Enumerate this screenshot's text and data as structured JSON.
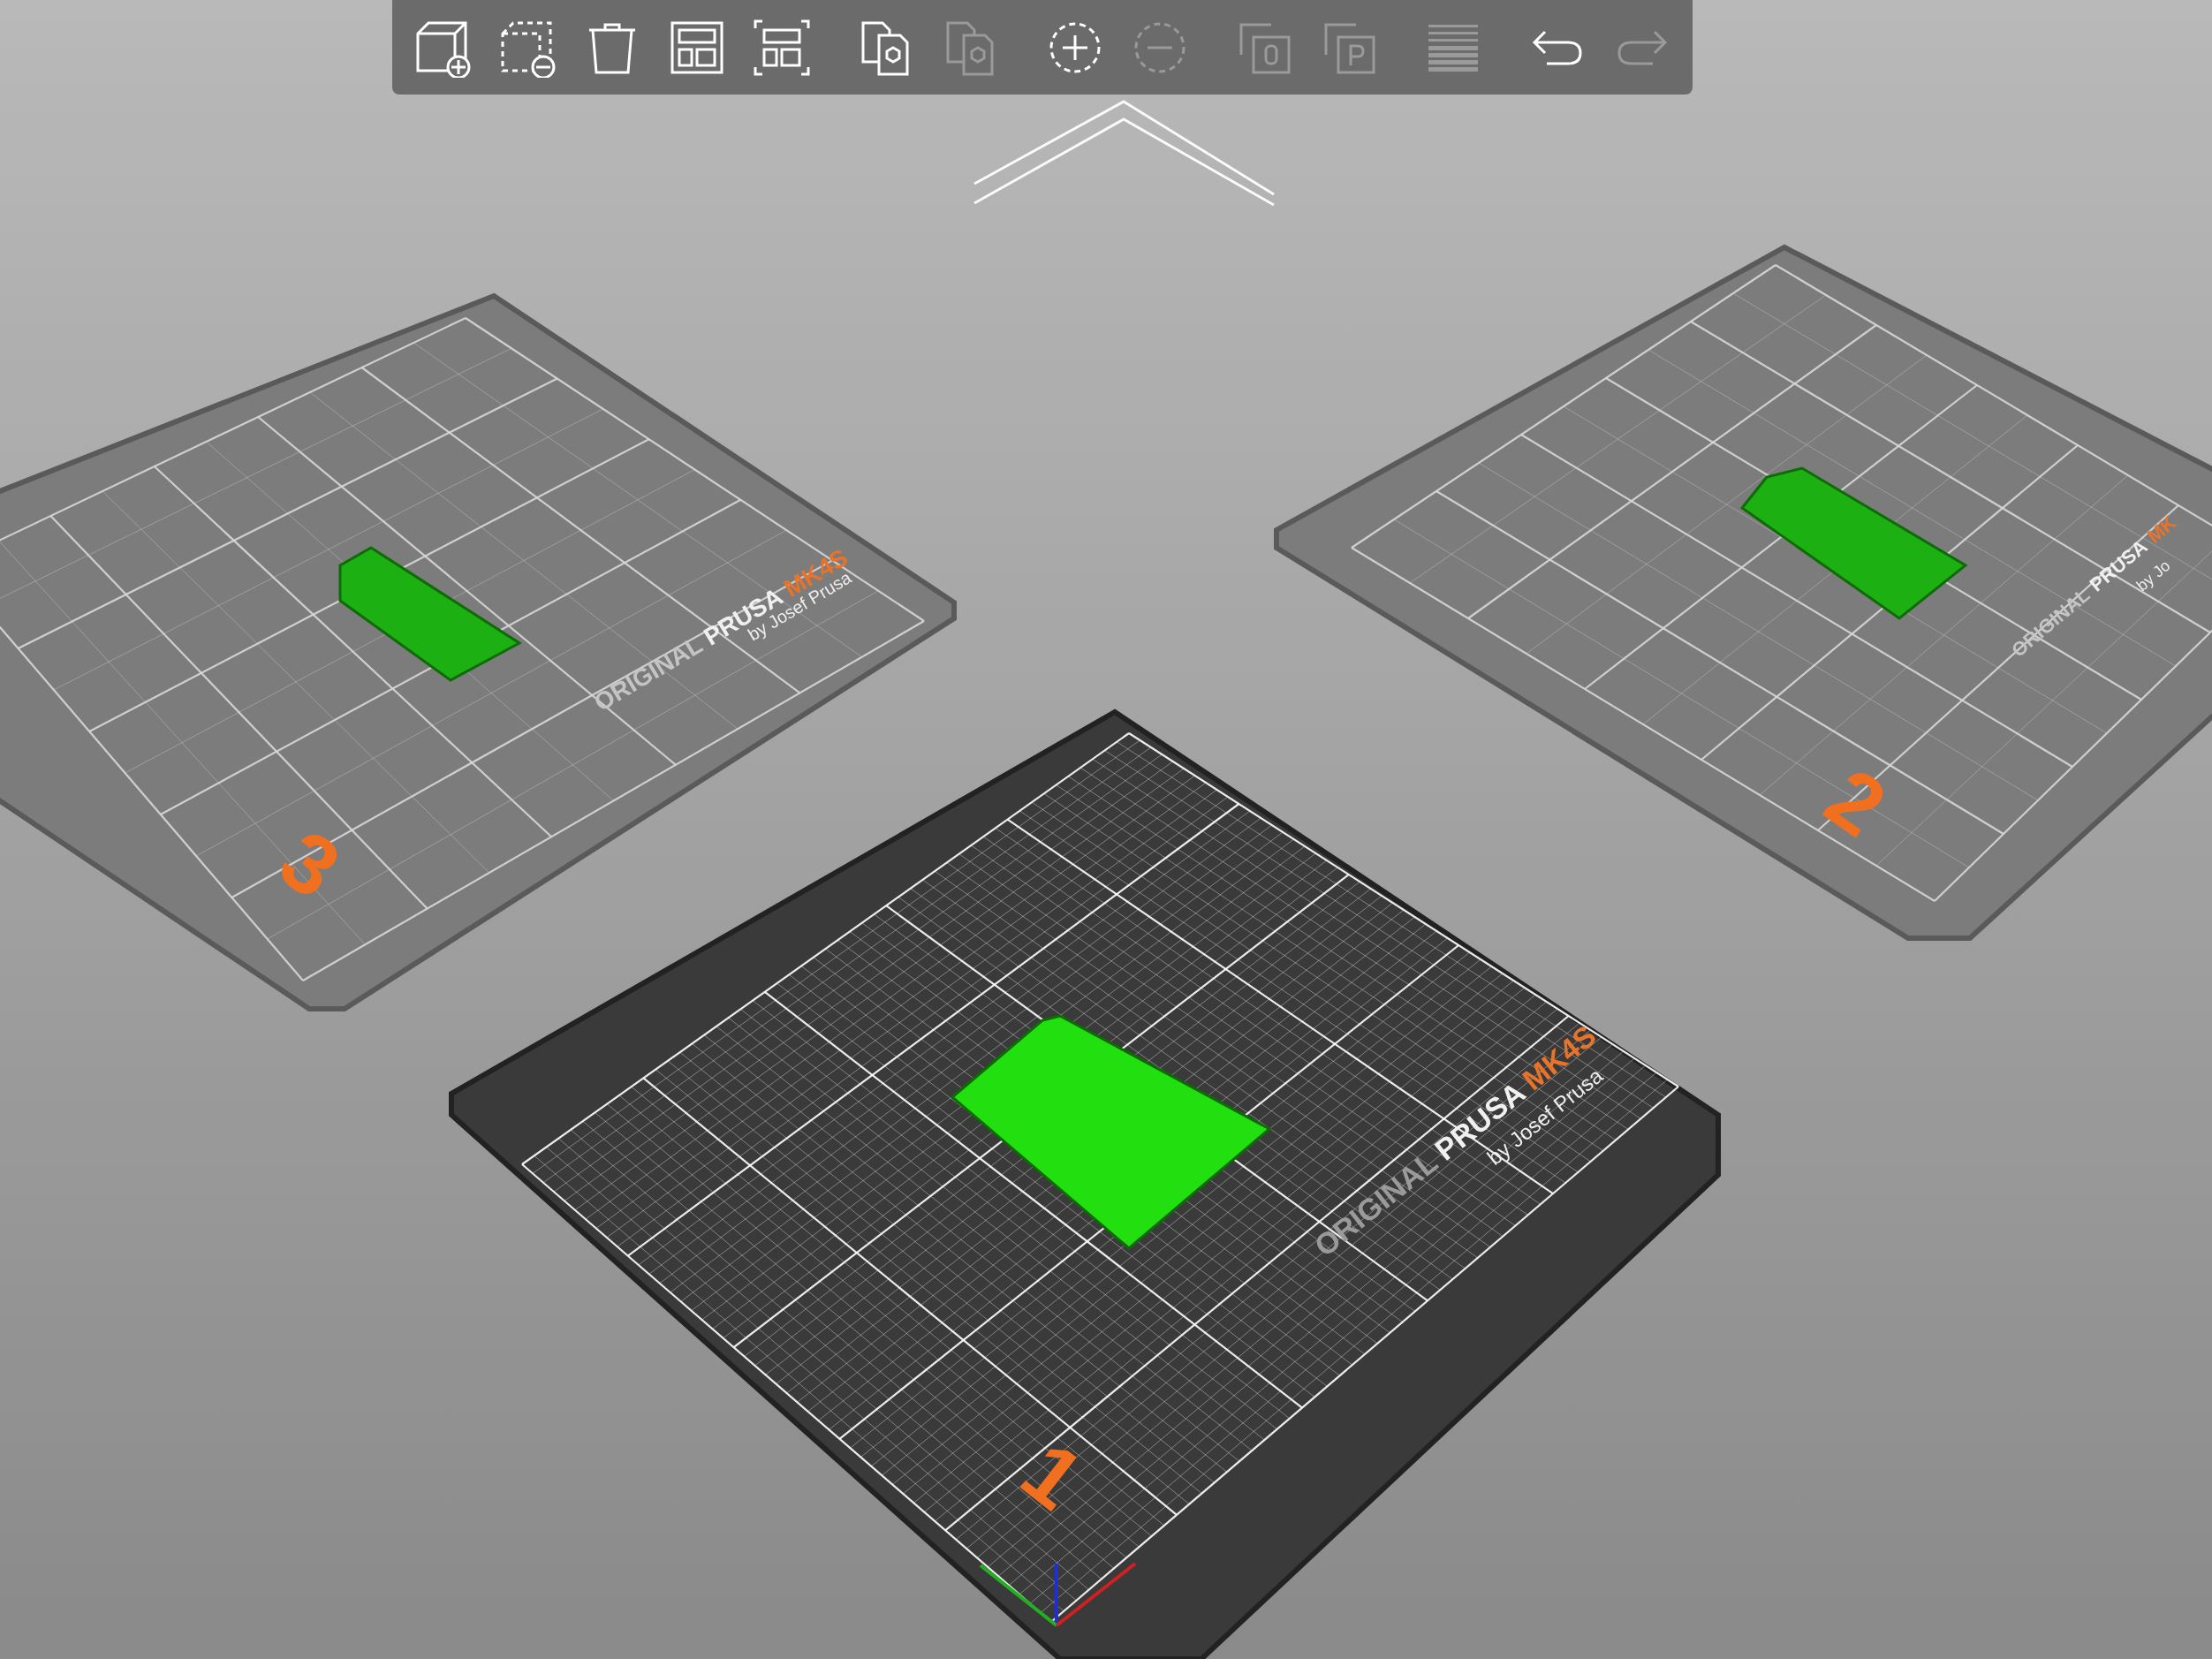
{
  "toolbar": {
    "tools": [
      {
        "kind": "add",
        "disabled": false,
        "group_start": false
      },
      {
        "kind": "delete",
        "disabled": false,
        "group_start": false
      },
      {
        "kind": "delete_all",
        "disabled": false,
        "group_start": false
      },
      {
        "kind": "arrange",
        "disabled": false,
        "group_start": false
      },
      {
        "kind": "arrange_selection",
        "disabled": false,
        "group_start": false
      },
      {
        "kind": "copy",
        "disabled": false,
        "group_start": true
      },
      {
        "kind": "paste",
        "disabled": true,
        "group_start": false
      },
      {
        "kind": "add_instance",
        "disabled": false,
        "group_start": true
      },
      {
        "kind": "remove_instance",
        "disabled": true,
        "group_start": false
      },
      {
        "kind": "split_objects",
        "disabled": true,
        "group_start": true
      },
      {
        "kind": "split_parts",
        "disabled": true,
        "group_start": false
      },
      {
        "kind": "layers",
        "disabled": true,
        "group_start": true
      },
      {
        "kind": "undo",
        "disabled": false,
        "group_start": true
      },
      {
        "kind": "redo",
        "disabled": true,
        "group_start": false
      }
    ]
  },
  "beds": [
    {
      "number": "1",
      "selected": true,
      "label": {
        "original": "ORIGINAL",
        "prusa": "PRUSA",
        "model": "MK4S",
        "byline": "by Josef Prusa"
      }
    },
    {
      "number": "2",
      "selected": false,
      "label": {
        "original": "ORIGINAL",
        "prusa": "PRUSA",
        "model": "MK",
        "byline": "by Jo"
      }
    },
    {
      "number": "3",
      "selected": false,
      "label": {
        "original": "ORIGINAL",
        "prusa": "PRUSA",
        "model": "MK4S",
        "byline": "by Josef Prusa"
      }
    }
  ]
}
